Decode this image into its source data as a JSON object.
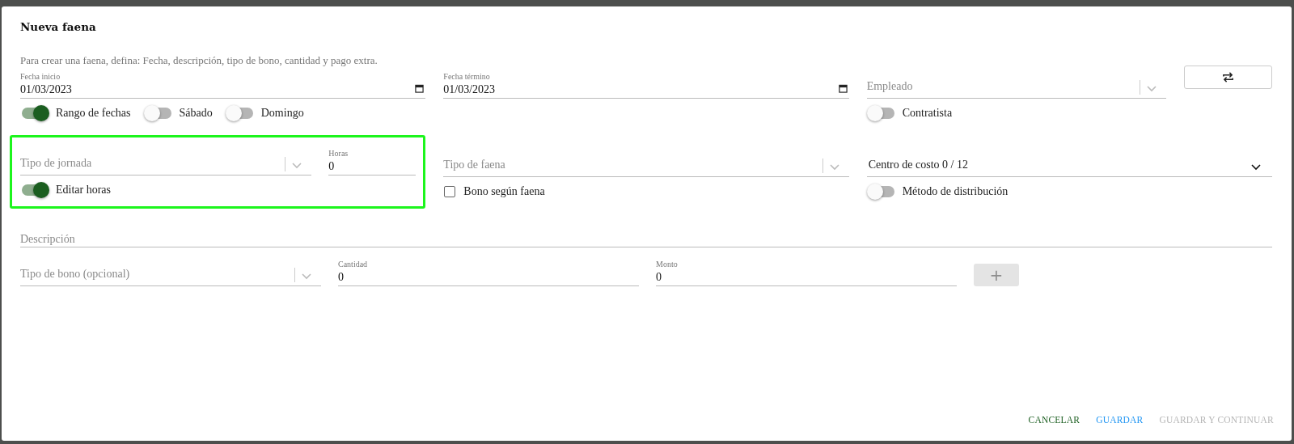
{
  "dialog": {
    "title": "Nueva faena",
    "intro": "Para crear una faena, defina: Fecha, descripción, tipo de bono, cantidad y pago extra.",
    "date_fields": [
      {
        "label": "Fecha inicio",
        "value": "01/03/2023"
      },
      {
        "label": "Fecha término",
        "value": "01/03/2023"
      }
    ],
    "employee_select": {
      "placeholder": "Empleado"
    },
    "date_toggles": [
      {
        "label": "Rango de fechas",
        "on": true
      },
      {
        "label": "Sábado",
        "on": false
      },
      {
        "label": "Domingo",
        "on": false
      }
    ],
    "contractor_toggle": {
      "label": "Contratista",
      "on": false
    },
    "workday_group": {
      "highlighted": true,
      "type_select": {
        "placeholder": "Tipo de jornada"
      },
      "hours": {
        "label": "Horas",
        "value": "0"
      },
      "edit_hours_toggle": {
        "label": "Editar horas",
        "on": true
      }
    },
    "task_type_select": {
      "placeholder": "Tipo de faena"
    },
    "bonus_by_task": {
      "label": "Bono según faena",
      "checked": false
    },
    "cost_center_select": {
      "value": "Centro de costo 0 / 12"
    },
    "distribution_toggle": {
      "label": "Método de distribución",
      "on": false
    },
    "description": {
      "placeholder": "Descripción"
    },
    "bonus_type_select": {
      "placeholder": "Tipo de bono (opcional)"
    },
    "quantity": {
      "label": "Cantidad",
      "value": "0"
    },
    "amount": {
      "label": "Monto",
      "value": "0"
    },
    "add_button": {
      "label": "+",
      "disabled": true
    },
    "actions": [
      {
        "label": "CANCELAR",
        "kind": "cancel",
        "disabled": false
      },
      {
        "label": "GUARDAR",
        "kind": "primary",
        "disabled": false
      },
      {
        "label": "GUARDAR Y CONTINUAR",
        "kind": "primary",
        "disabled": true
      }
    ]
  }
}
